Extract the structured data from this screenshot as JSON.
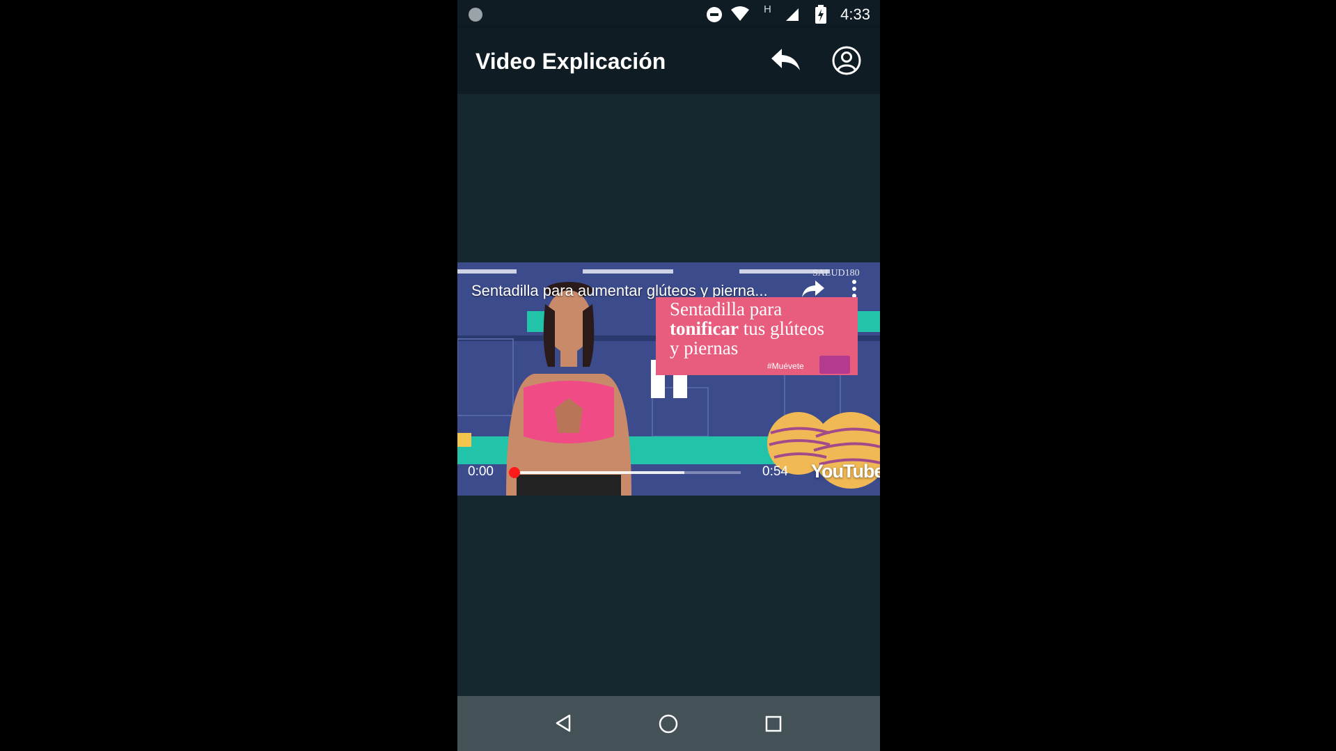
{
  "status_bar": {
    "time": "4:33",
    "network_type": "H",
    "icons": [
      "notification-dot-icon",
      "do-not-disturb-icon",
      "wifi-icon",
      "cell-signal-icon",
      "battery-charging-icon"
    ]
  },
  "app_bar": {
    "title": "Video Explicación",
    "actions": [
      "reply-icon",
      "account-icon"
    ]
  },
  "video_player": {
    "title": "Sentadilla para aumentar glúteos y pierna...",
    "overlay_card": {
      "line1": "Sentadilla para",
      "line2_bold": "tonificar",
      "line2_rest": " tus glúteos",
      "line3": "y piernas",
      "hashtag": "#Muévete",
      "watermark": "SALUD180"
    },
    "current_time": "0:00",
    "total_time": "0:54",
    "brand": "YouTube",
    "state": "playing",
    "progress_fraction": 0,
    "buffered_fraction": 0.75
  },
  "nav_bar": {
    "buttons": [
      "back-triangle-icon",
      "home-circle-icon",
      "recents-square-icon"
    ]
  },
  "colors": {
    "app_bar_bg": "#0f1c24",
    "content_bg": "#15282f",
    "nav_bar_bg": "#445257",
    "promo_pink": "#e85d7e",
    "seek_red": "#ff1a1a"
  }
}
